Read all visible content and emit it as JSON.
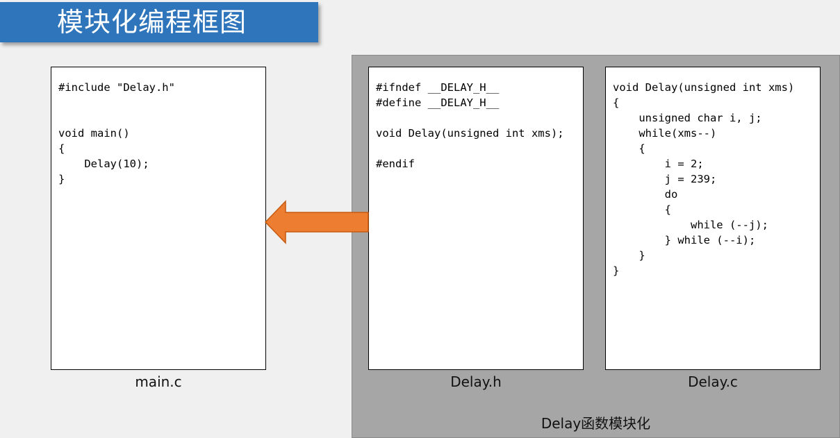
{
  "title": "模块化编程框图",
  "files": {
    "main_c": {
      "name": "main.c",
      "code": "#include \"Delay.h\"\n\n\nvoid main()\n{\n    Delay(10);\n}"
    },
    "delay_h": {
      "name": "Delay.h",
      "code": "#ifndef __DELAY_H__\n#define __DELAY_H__\n\nvoid Delay(unsigned int xms);\n\n#endif"
    },
    "delay_c": {
      "name": "Delay.c",
      "code": "void Delay(unsigned int xms)\n{\n    unsigned char i, j;\n    while(xms--)\n    {\n        i = 2;\n        j = 239;\n        do\n        {\n            while (--j);\n        } while (--i);\n    }\n}"
    }
  },
  "group_label": "Delay函数模块化",
  "colors": {
    "title_bg": "#2f75bb",
    "group_bg": "#a6a6a6",
    "arrow": "#ed7d31",
    "arrow_border": "#c55a11",
    "page_bg": "#f0f0f0"
  }
}
